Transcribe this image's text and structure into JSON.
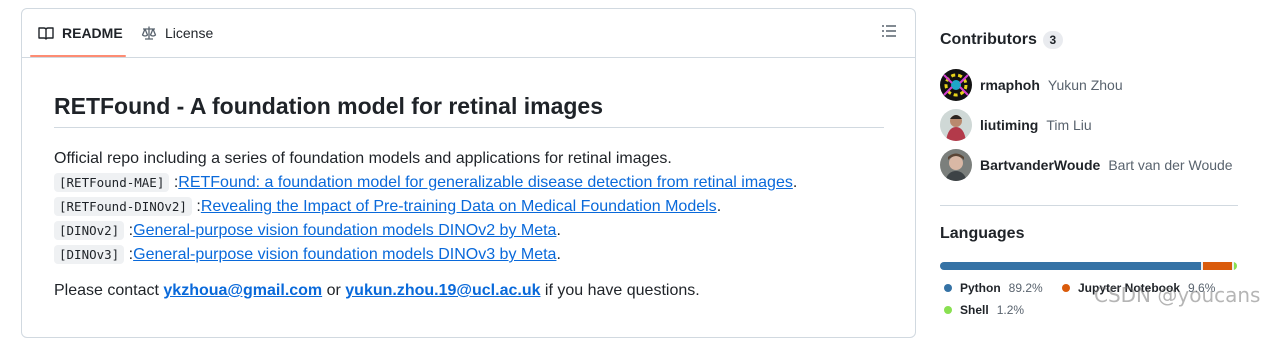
{
  "tabs": {
    "readme": "README",
    "license": "License"
  },
  "readme": {
    "title": "RETFound - A foundation model for retinal images",
    "intro": "Official repo including a series of foundation models and applications for retinal images.",
    "items": [
      {
        "code": "[RETFound-MAE]",
        "sep": ":",
        "link": "RETFound: a foundation model for generalizable disease detection from retinal images",
        "end": "."
      },
      {
        "code": "[RETFound-DINOv2]",
        "sep": ":",
        "link": "Revealing the Impact of Pre-training Data on Medical Foundation Models",
        "end": "."
      },
      {
        "code": "[DINOv2]",
        "sep": ":",
        "link": "General-purpose vision foundation models DINOv2 by Meta",
        "end": "."
      },
      {
        "code": "[DINOv3]",
        "sep": ":",
        "link": "General-purpose vision foundation models DINOv3 by Meta",
        "end": "."
      }
    ],
    "contact": {
      "prefix": "Please contact ",
      "email1": "ykzhoua@gmail.com",
      "middle": " or ",
      "email2": "yukun.zhou.19@ucl.ac.uk",
      "suffix": " if you have questions."
    }
  },
  "sidebar": {
    "contributors_title": "Contributors",
    "contributors_count": "3",
    "contributors": [
      {
        "login": "rmaphoh",
        "name": "Yukun Zhou"
      },
      {
        "login": "liutiming",
        "name": "Tim Liu"
      },
      {
        "login": "BartvanderWoude",
        "name": "Bart van der Woude"
      }
    ],
    "languages_title": "Languages",
    "languages": [
      {
        "name": "Python",
        "pct": "89.2%",
        "value": 89.2,
        "color": "#3572A5"
      },
      {
        "name": "Jupyter Notebook",
        "pct": "9.6%",
        "value": 9.6,
        "color": "#DA5B0B"
      },
      {
        "name": "Shell",
        "pct": "1.2%",
        "value": 1.2,
        "color": "#89e051"
      }
    ]
  },
  "watermark": "CSDN @youcans"
}
